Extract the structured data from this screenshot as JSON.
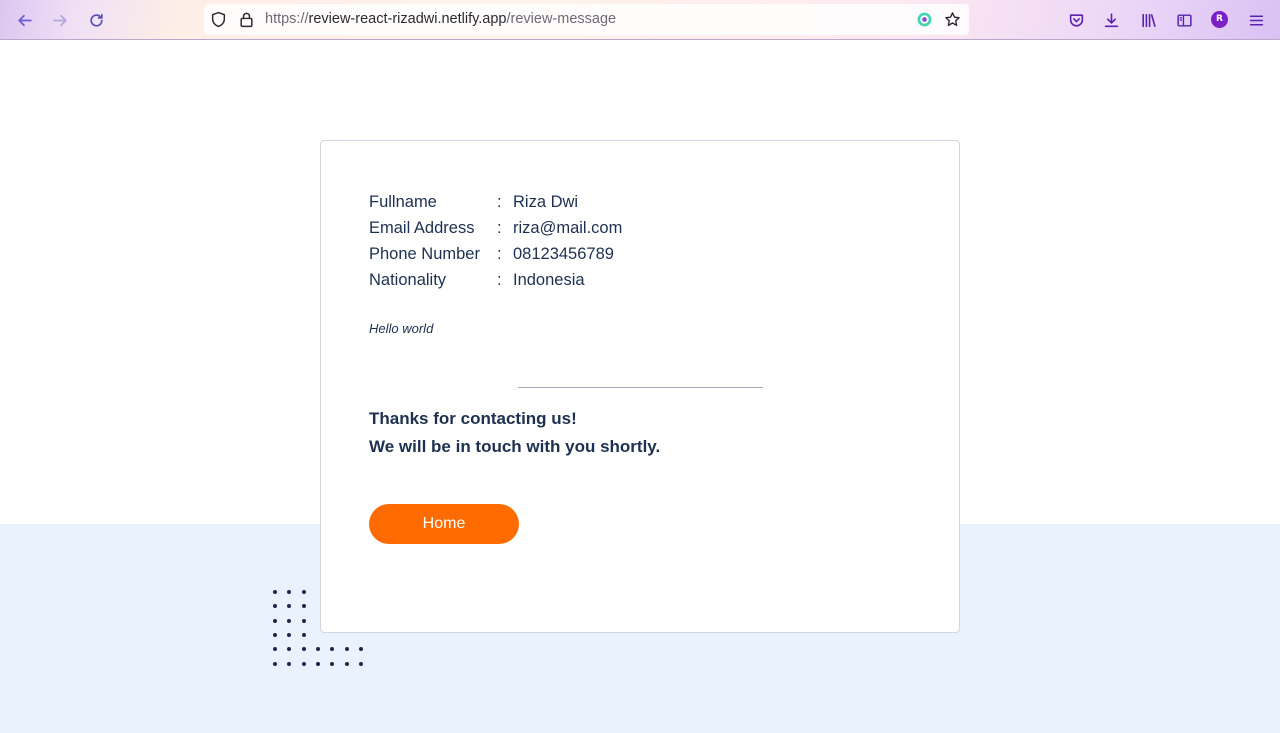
{
  "browser": {
    "url_prefix": "https://",
    "url_host": "review-react-rizadwi.netlify.app",
    "url_path": "/review-message",
    "profile_initial": "R",
    "icons": {
      "back": "back-arrow-icon",
      "forward": "forward-arrow-icon",
      "reload": "reload-icon",
      "tracking": "shield-icon",
      "lock": "lock-icon",
      "extension": "extension-icon",
      "bookmark": "star-icon",
      "pocket": "pocket-icon",
      "downloads": "download-icon",
      "library": "library-icon",
      "sidebar": "sidebar-icon",
      "menu": "hamburger-menu-icon"
    }
  },
  "review": {
    "fields": [
      {
        "label": "Fullname",
        "value": "Riza Dwi"
      },
      {
        "label": "Email Address",
        "value": "riza@mail.com"
      },
      {
        "label": "Phone Number",
        "value": "08123456789"
      },
      {
        "label": "Nationality",
        "value": "Indonesia"
      }
    ],
    "separator": ":",
    "message": "Hello world",
    "thanks_line1": "Thanks for contacting us!",
    "thanks_line2": "We will be in touch with you shortly.",
    "home_button": "Home"
  },
  "colors": {
    "accent": "#ff6b00",
    "text": "#1e3050",
    "band": "#eaf3fd"
  }
}
